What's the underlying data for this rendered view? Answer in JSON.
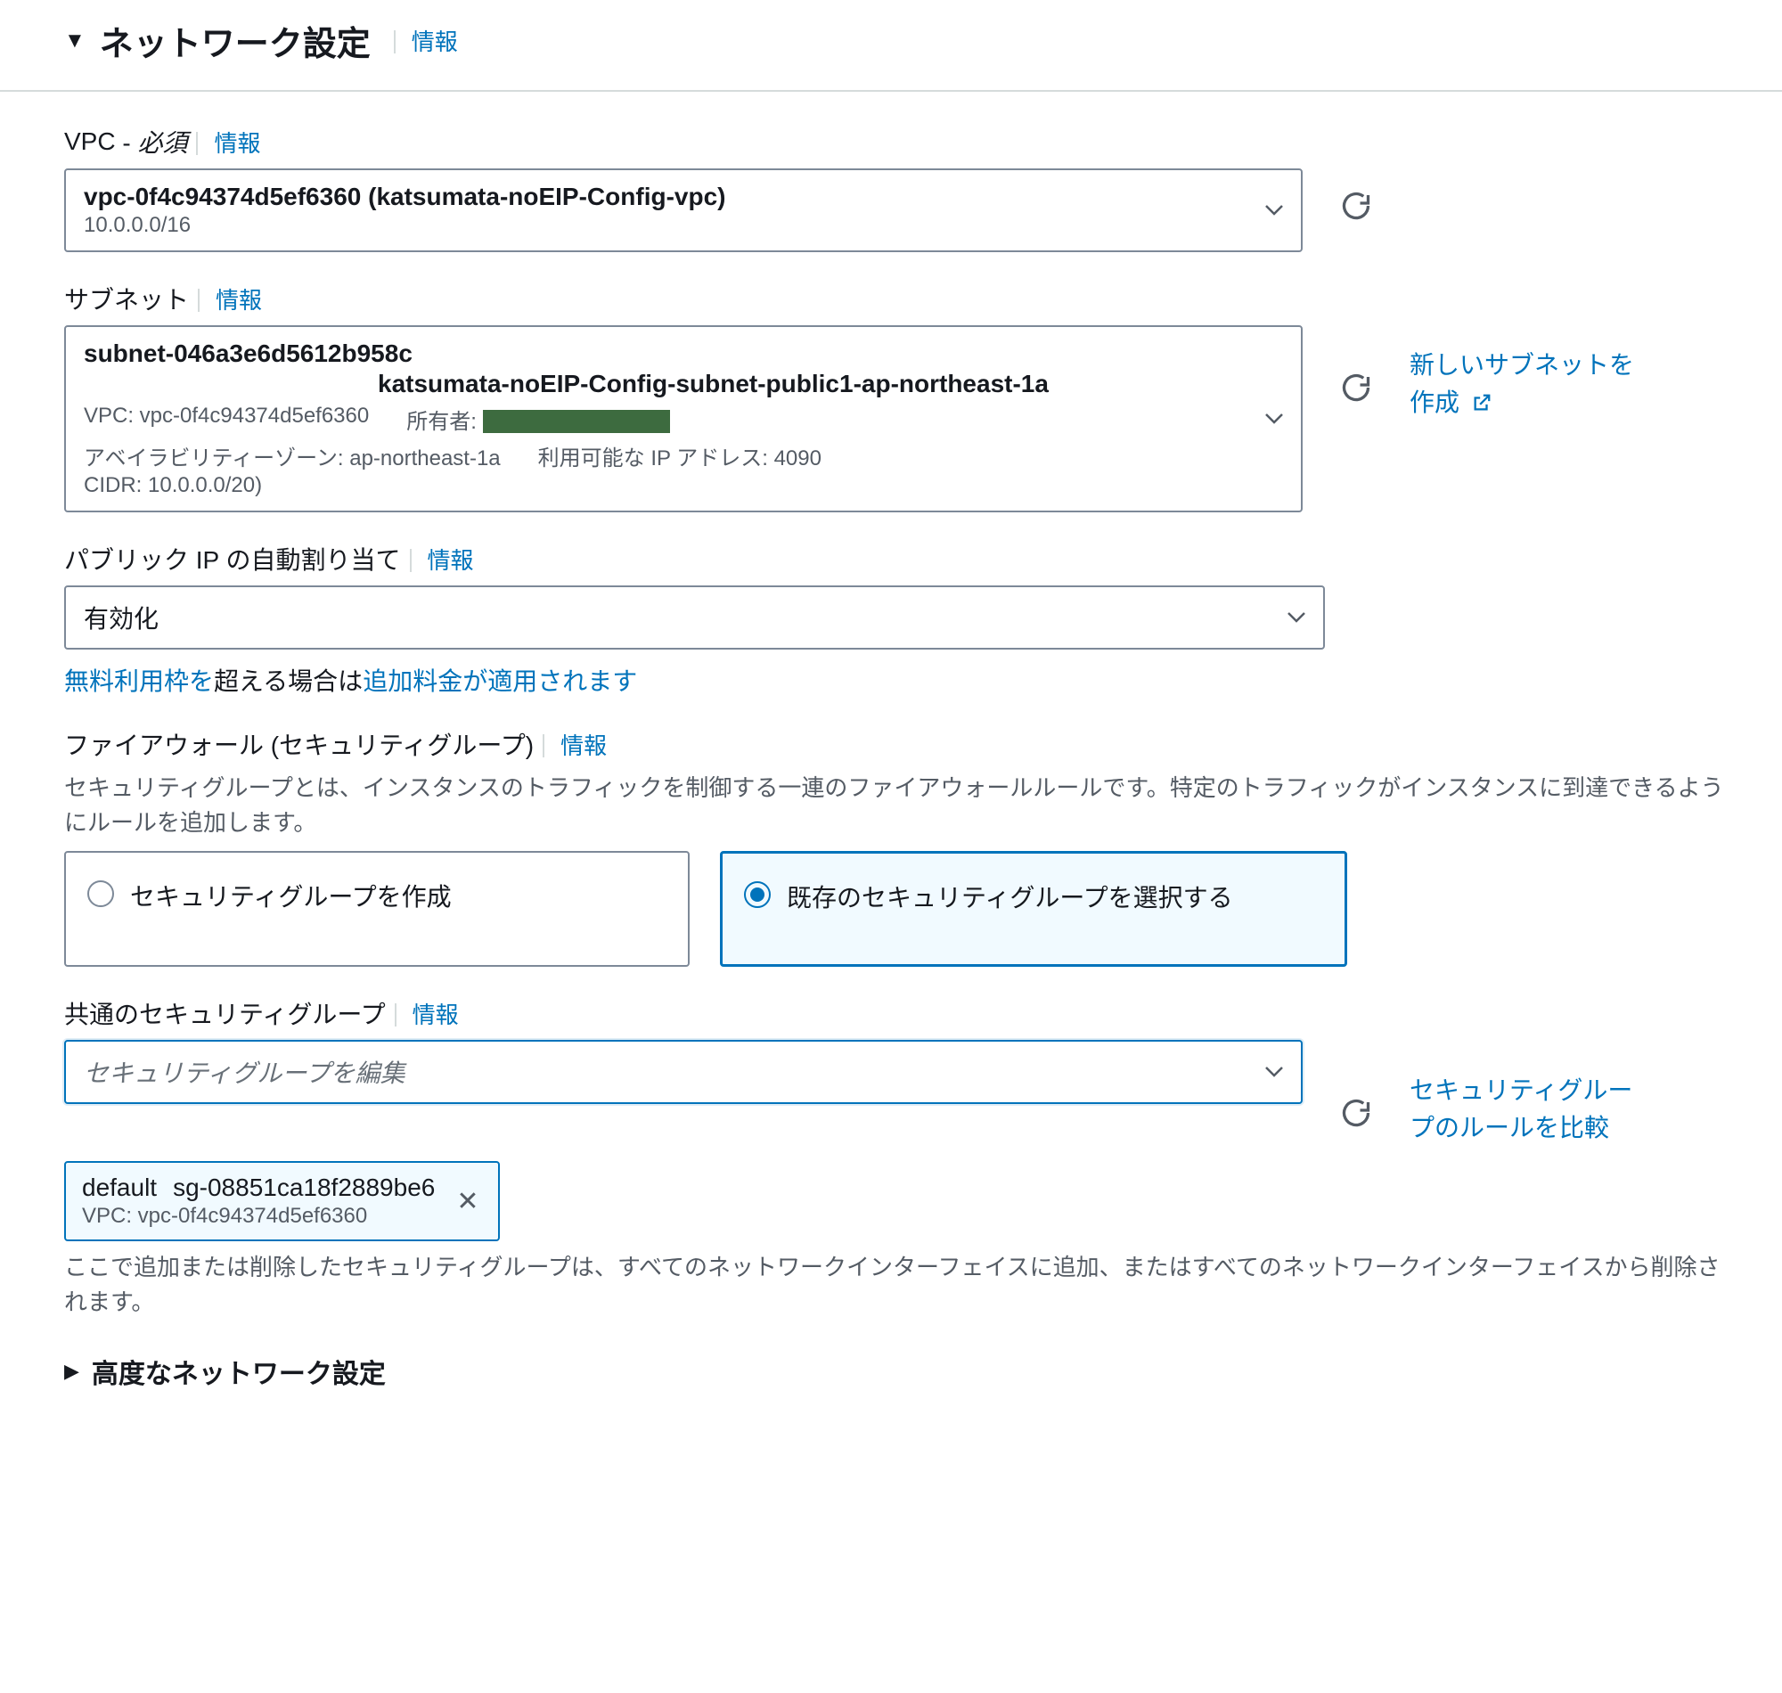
{
  "header": {
    "title": "ネットワーク設定",
    "info": "情報"
  },
  "vpc": {
    "label": "VPC",
    "required": "必須",
    "info": "情報",
    "value": "vpc-0f4c94374d5ef6360 (katsumata-noEIP-Config-vpc)",
    "cidr": "10.0.0.0/16"
  },
  "subnet": {
    "label": "サブネット",
    "info": "情報",
    "id": "subnet-046a3e6d5612b958c",
    "name": "katsumata-noEIP-Config-subnet-public1-ap-northeast-1a",
    "vpc_prefix": "VPC: vpc-0f4c94374d5ef6360",
    "owner_prefix": "所有者:",
    "az": "アベイラビリティーゾーン: ap-northeast-1a",
    "avail_ip": "利用可能な IP アドレス: 4090",
    "cidr": "CIDR: 10.0.0.0/20)",
    "create_link": "新しいサブネットを作成"
  },
  "publicip": {
    "label": "パブリック IP の自動割り当て",
    "info": "情報",
    "value": "有効化",
    "free_tier_1": "無料利用枠を",
    "free_tier_mid": "超える場合は",
    "free_tier_2": "追加料金が適用されます"
  },
  "firewall": {
    "label": "ファイアウォール (セキュリティグループ)",
    "info": "情報",
    "description": "セキュリティグループとは、インスタンスのトラフィックを制御する一連のファイアウォールルールです。特定のトラフィックがインスタンスに到達できるようにルールを追加します。",
    "option_create": "セキュリティグループを作成",
    "option_existing": "既存のセキュリティグループを選択する"
  },
  "commonsg": {
    "label": "共通のセキュリティグループ",
    "info": "情報",
    "placeholder": "セキュリティグループを編集",
    "token_name": "default",
    "token_id": "sg-08851ca18f2889be6",
    "token_vpc": "VPC: vpc-0f4c94374d5ef6360",
    "helper": "ここで追加または削除したセキュリティグループは、すべてのネットワークインターフェイスに追加、またはすべてのネットワークインターフェイスから削除されます。",
    "compare_link": "セキュリティグループのルールを比較"
  },
  "advanced": {
    "label": "高度なネットワーク設定"
  }
}
